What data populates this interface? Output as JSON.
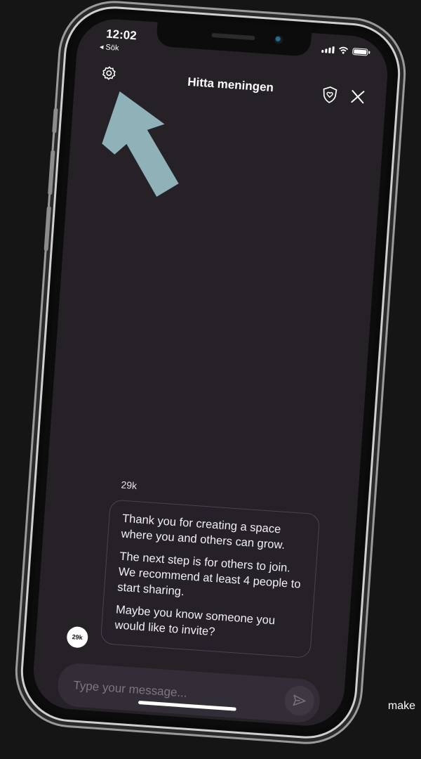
{
  "status_bar": {
    "time": "12:02",
    "back_label": "◂ Sök"
  },
  "header": {
    "title": "Hitta meningen",
    "settings_icon": "gear-icon",
    "shield_icon": "shield-heart-icon",
    "close_icon": "close-icon"
  },
  "overlay": {
    "arrow_color": "#8fb1b8"
  },
  "chat": {
    "sender_name": "29k",
    "avatar_label": "29k",
    "message_paragraphs": [
      "Thank you for creating a space where you and others can grow.",
      "The next step is for others to join. We recommend at least 4 people to start sharing.",
      "Maybe you know someone you would like to invite?"
    ]
  },
  "composer": {
    "placeholder": "Type your message...",
    "send_icon": "send-icon"
  },
  "page_edge_text": "make",
  "colors": {
    "background": "#151515",
    "screen": "#252127",
    "bubble_border": "#4a4350",
    "composer": "#322d36"
  }
}
